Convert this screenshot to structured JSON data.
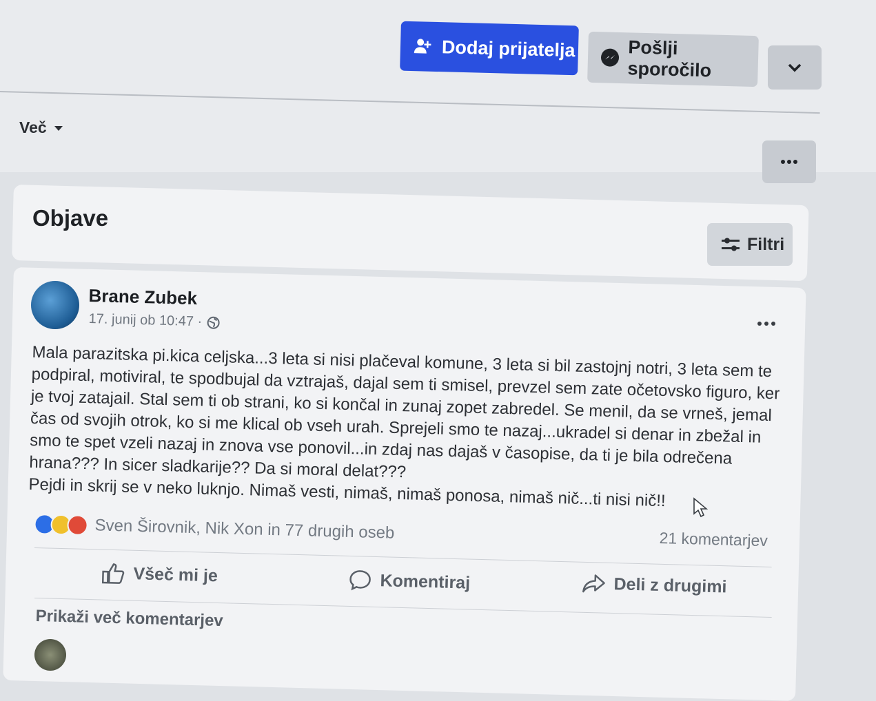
{
  "profile_actions": {
    "add_friend": "Dodaj prijatelja",
    "send_message": "Pošlji sporočilo"
  },
  "nav": {
    "more_label": "Več"
  },
  "posts_section": {
    "title": "Objave",
    "filters_label": "Filtri"
  },
  "post": {
    "author": "Brane Zubek",
    "timestamp": "17. junij ob 10:47 ·",
    "visibility_icon": "globe-icon",
    "text": "Mala parazitska pi.kica celjska...3 leta si nisi plačeval komune, 3 leta si bil zastojnj notri, 3 leta sem te podpiral, motiviral, te spodbujal da vztrajaš, dajal sem ti smisel, prevzel sem zate očetovsko figuro, ker je tvoj zatajail. Stal sem ti ob strani, ko si končal in zunaj zopet zabredel. Se menil, da se vrneš, jemal čas od svojih otrok, ko si me klical ob vseh urah. Sprejeli smo te nazaj...ukradel si denar in zbežal in smo te spet vzeli nazaj in znova vse ponovil...in zdaj nas dajaš v časopise, da ti je bila odrečena hrana??? In sicer sladkarije?? Da si moral delat???\nPejdi in skrij se v neko luknjo. Nimaš vesti, nimaš, nimaš ponosa, nimaš nič...ti nisi nič!!",
    "reactions_text": "Sven Širovnik, Nik Xon in 77 drugih oseb",
    "reaction_icons": [
      "like-icon",
      "sad-icon",
      "angry-icon"
    ],
    "comments_count": "21 komentarjev",
    "actions": {
      "like": "Všeč mi je",
      "comment": "Komentiraj",
      "share": "Deli z drugimi"
    },
    "show_more_comments": "Prikaži več komentarjev"
  },
  "colors": {
    "accent": "#2a50e0",
    "background": "#dfe2e6",
    "card": "#f2f3f5"
  }
}
